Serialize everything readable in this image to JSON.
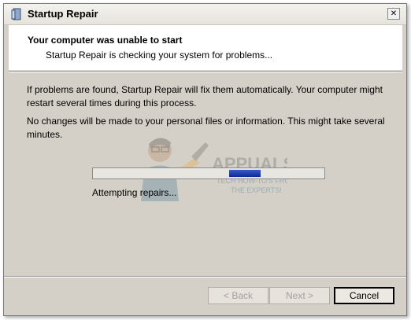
{
  "window": {
    "title": "Startup Repair",
    "close_glyph": "✕"
  },
  "header": {
    "heading": "Your computer was unable to start",
    "subheading": "Startup Repair is checking your system for problems..."
  },
  "body": {
    "paragraph1": "If problems are found, Startup Repair will fix them automatically. Your computer might restart several times during this process.",
    "paragraph2": "No changes will be made to your personal files or information. This might take several minutes."
  },
  "progress": {
    "segment_start_fraction": 0.59,
    "segment_width_fraction": 0.135,
    "status_text": "Attempting repairs..."
  },
  "buttons": {
    "back_label": "< Back",
    "next_label": "Next >",
    "cancel_label": "Cancel"
  },
  "watermark": {
    "brand": "APPUALS",
    "tagline_line1": "TECH HOW-TO'S FROM",
    "tagline_line2": "THE EXPERTS!"
  },
  "colors": {
    "dialog_bg": "#d4d0c8",
    "progress_fill": "#0a2a9a"
  }
}
